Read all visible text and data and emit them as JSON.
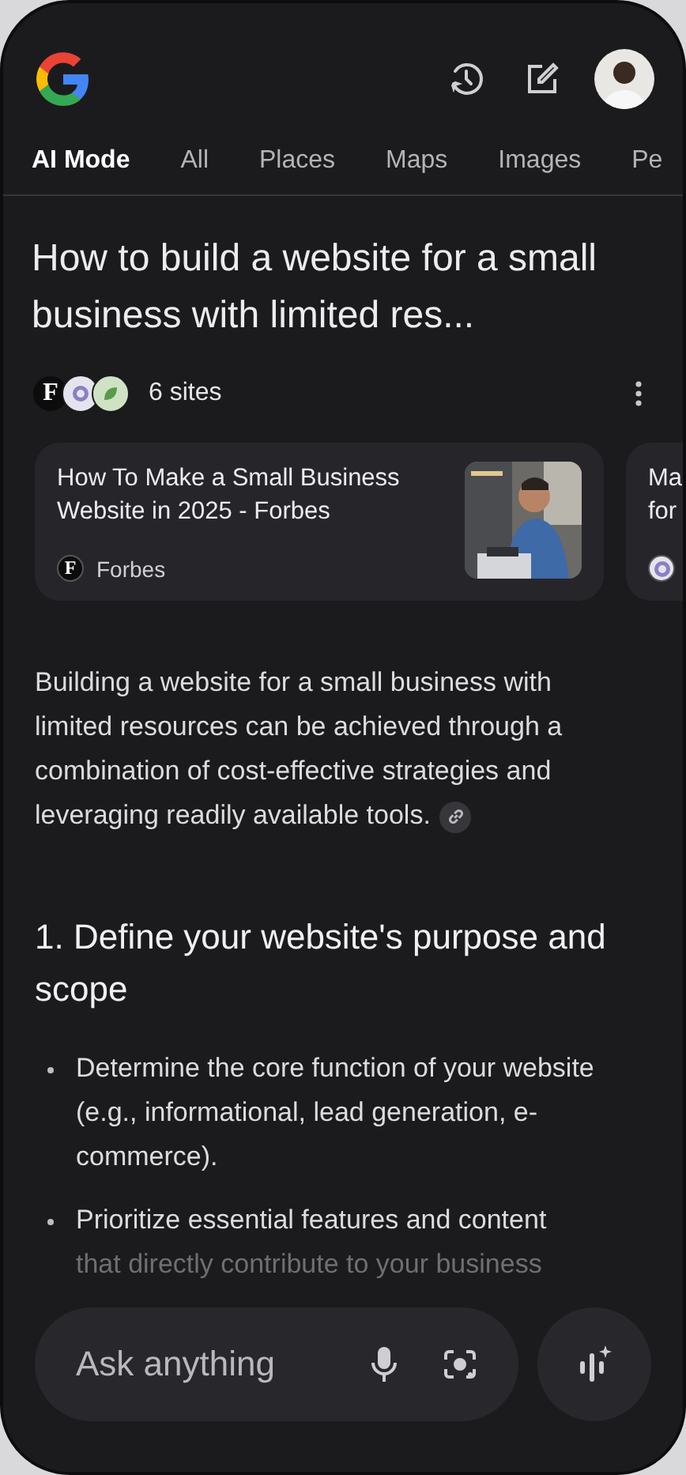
{
  "tabs": [
    {
      "label": "AI Mode",
      "selected": true
    },
    {
      "label": "All",
      "selected": false
    },
    {
      "label": "Places",
      "selected": false
    },
    {
      "label": "Maps",
      "selected": false
    },
    {
      "label": "Images",
      "selected": false
    },
    {
      "label": "Pe",
      "selected": false
    }
  ],
  "title": "How to build a website for a small business with limited res...",
  "sources": {
    "count_label": "6 sites",
    "icons": [
      {
        "kind": "letter",
        "text": "F"
      },
      {
        "kind": "emblem"
      },
      {
        "kind": "leaf"
      }
    ]
  },
  "cards": [
    {
      "title": "How To Make a Small Business Website in 2025 - Forbes",
      "source": {
        "kind": "letter",
        "icon_text": "F",
        "name": "Forbes"
      }
    },
    {
      "title": "Ma\nfor",
      "source": {
        "kind": "emblem"
      }
    }
  ],
  "summary": "Building a website for a small business with limited resources can be achieved through a combination of cost-effective strategies and leveraging readily available tools.",
  "section_heading": "1. Define your website's purpose and scope",
  "bullets": [
    {
      "text": "Determine the core function of your website (e.g., informational, lead generation, e-commerce).",
      "faded": false
    },
    {
      "text": "Prioritize essential features and content",
      "faded": false,
      "continuation": "that directly contribute to your business"
    }
  ],
  "input": {
    "placeholder": "Ask anything"
  }
}
